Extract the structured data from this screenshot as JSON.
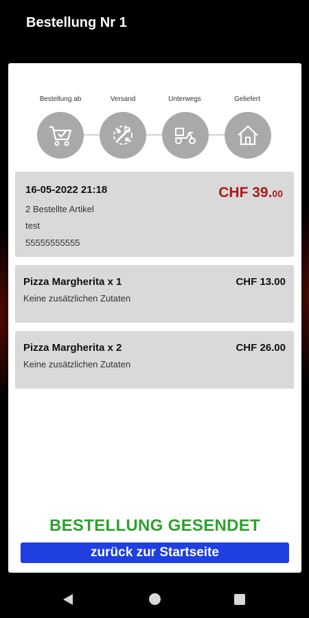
{
  "header": {
    "title": "Bestellung Nr 1"
  },
  "steps": [
    {
      "label": "Bestellung ab",
      "icon": "cart-check-icon"
    },
    {
      "label": "Versand",
      "icon": "shipping-tools-icon"
    },
    {
      "label": "Unterwegs",
      "icon": "scooter-icon"
    },
    {
      "label": "Geliefert",
      "icon": "house-icon"
    }
  ],
  "summary": {
    "date": "16-05-2022 21:18",
    "item_count": "2 Bestellte Artikel",
    "name": "test",
    "phone": "55555555555",
    "price_main": "CHF 39.",
    "price_cents": "00"
  },
  "items": [
    {
      "name": "Pizza Margherita x 1",
      "extras": "Keine zusätzlichen Zutaten",
      "price": "CHF 13.00"
    },
    {
      "name": "Pizza Margherita x 2",
      "extras": "Keine zusätzlichen Zutaten",
      "price": "CHF 26.00"
    }
  ],
  "status": {
    "sent_label": "BESTELLUNG GESENDET"
  },
  "actions": {
    "home_label": "zurück zur Startseite"
  },
  "colors": {
    "accent_red": "#b01818",
    "success_green": "#2ea02e",
    "button_blue": "#1f3fe0",
    "step_gray": "#a9a9a9"
  },
  "system_nav": {
    "icons": [
      "back-icon",
      "home-icon",
      "recent-apps-icon"
    ]
  }
}
